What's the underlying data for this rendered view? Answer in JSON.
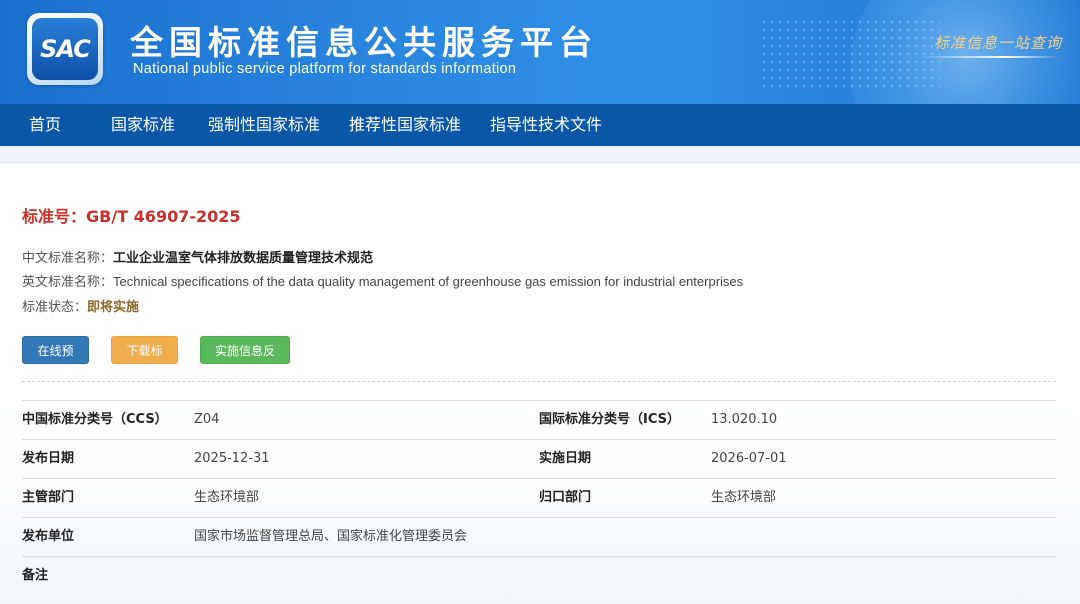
{
  "header": {
    "logo_text": "SAC",
    "title": "全国标准信息公共服务平台",
    "subtitle": "National public service platform  for standards information",
    "slogan": "标准信息一站查询"
  },
  "nav": {
    "items": [
      {
        "label": "首页"
      },
      {
        "label": "国家标准"
      },
      {
        "label": "强制性国家标准"
      },
      {
        "label": "推荐性国家标准"
      },
      {
        "label": "指导性技术文件"
      }
    ]
  },
  "standard": {
    "number_label": "标准号：",
    "number": "GB/T 46907-2025",
    "cn_name_label": "中文标准名称：",
    "cn_name": "工业企业温室气体排放数据质量管理技术规范",
    "en_name_label": "英文标准名称：",
    "en_name": "Technical specifications of the data quality management of greenhouse gas emission for industrial enterprises",
    "status_label": "标准状态：",
    "status": "即将实施"
  },
  "actions": {
    "preview": "在线预览",
    "download": "下载标准",
    "feedback": "实施信息反馈"
  },
  "details": {
    "rows": [
      {
        "k1": "中国标准分类号（CCS）",
        "v1": "Z04",
        "k2": "国际标准分类号（ICS）",
        "v2": "13.020.10"
      },
      {
        "k1": "发布日期",
        "v1": "2025-12-31",
        "k2": "实施日期",
        "v2": "2026-07-01"
      },
      {
        "k1": "主管部门",
        "v1": "生态环境部",
        "k2": "归口部门",
        "v2": "生态环境部"
      },
      {
        "k1": "发布单位",
        "v1": "国家市场监督管理总局、国家标准化管理委员会",
        "k2": "",
        "v2": ""
      },
      {
        "k1": "备注",
        "v1": "",
        "k2": "",
        "v2": ""
      }
    ]
  },
  "colors": {
    "banner": "#2a86df",
    "nav": "#0a57a8",
    "std_number": "#c9302c",
    "status": "#8a6a2a",
    "btn_preview": "#3379b8",
    "btn_download": "#f0ad4e",
    "btn_feedback": "#5cb85c"
  }
}
